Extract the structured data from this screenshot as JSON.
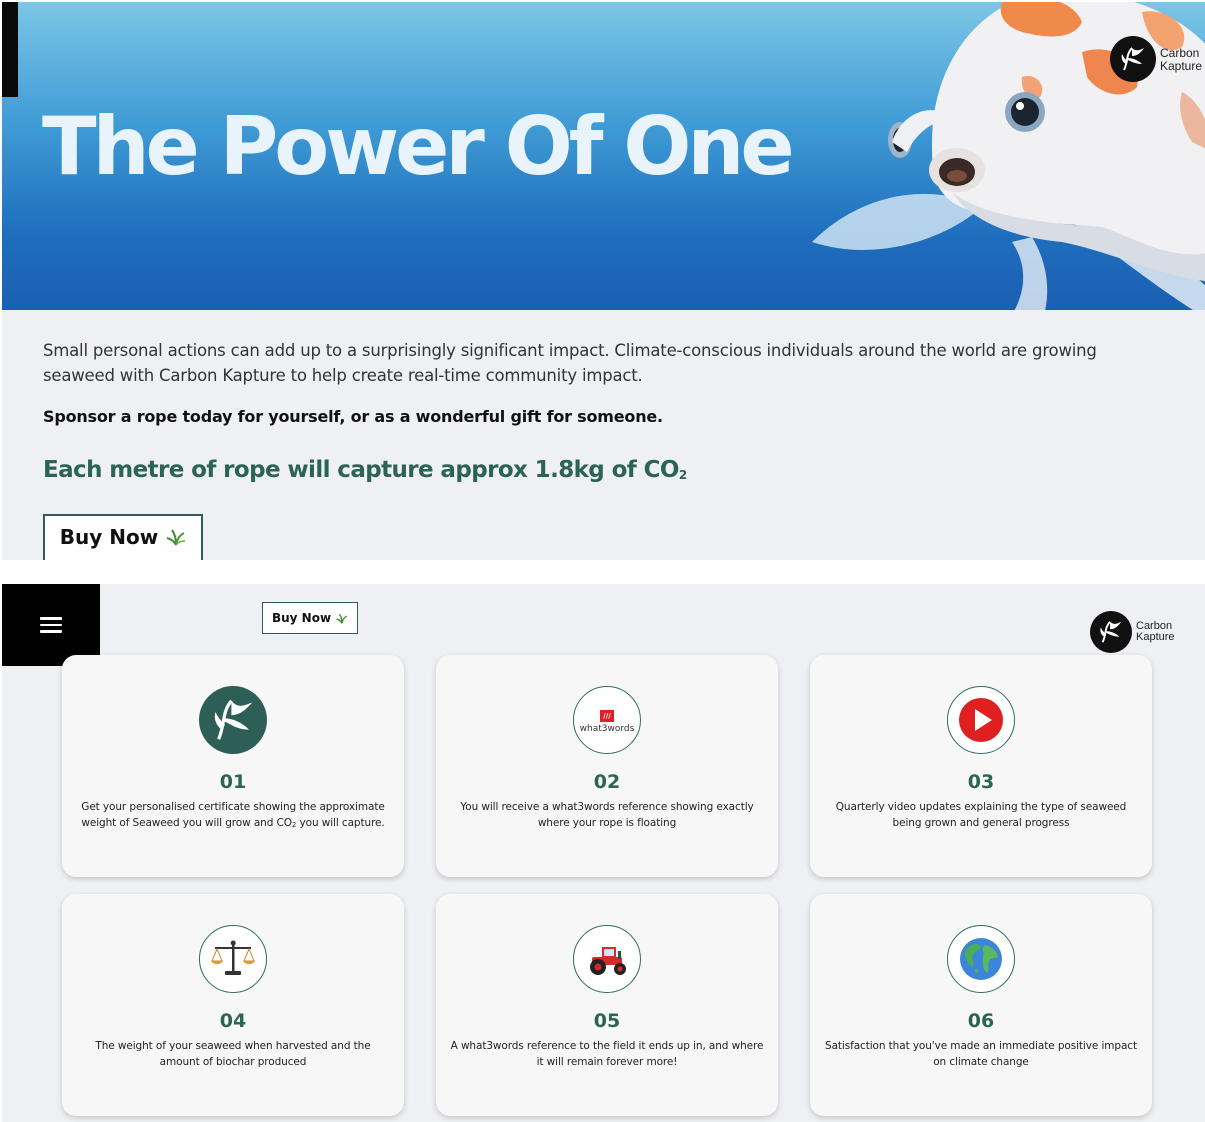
{
  "hero": {
    "title": "The Power Of One",
    "brand_line1": "Carbon",
    "brand_line2": "Kapture"
  },
  "intro": {
    "paragraph": "Small personal actions can add up to a surprisingly significant impact. Climate-conscious individuals around the world are growing seaweed with Carbon Kapture to help create real-time community impact.",
    "sponsor_text": "Sponsor a rope today for yourself, or as a wonderful gift for someone.",
    "co2_prefix": "Each metre of rope will capture approx 1.8kg of CO",
    "co2_sub": "2"
  },
  "buttons": {
    "buy_now": "Buy Now"
  },
  "nav": {
    "brand_line1": "Carbon",
    "brand_line2": "Kapture"
  },
  "cards": [
    {
      "number": "01",
      "icon": "seaweed-logo-icon",
      "text_a": "Get your personalised certificate showing the approximate weight of Seaweed you will grow and CO",
      "text_sub": "2",
      "text_b": " you will capture."
    },
    {
      "number": "02",
      "icon": "what3words-icon",
      "icon_label": "what3words",
      "text": "You will receive a what3words reference showing exactly where your rope is floating"
    },
    {
      "number": "03",
      "icon": "play-video-icon",
      "text": "Quarterly video updates explaining the type of seaweed being grown and general progress"
    },
    {
      "number": "04",
      "icon": "scales-icon",
      "text": "The weight of your seaweed when harvested and the amount of biochar produced"
    },
    {
      "number": "05",
      "icon": "tractor-icon",
      "text": "A what3words reference to the field it ends up in, and where it will remain forever more!"
    },
    {
      "number": "06",
      "icon": "globe-icon",
      "text": "Satisfaction that you've made an immediate positive impact on climate change"
    }
  ],
  "colors": {
    "accent_green": "#2b6450",
    "button_border": "#2d5f57",
    "panel_bg": "#eff0f4",
    "play_red": "#e02020",
    "what3words_red": "#e11f26"
  }
}
